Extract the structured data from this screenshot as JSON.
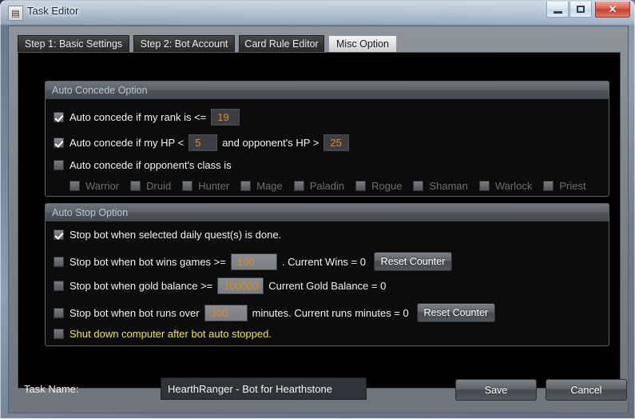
{
  "window": {
    "title": "Task Editor",
    "icon": "app-icon",
    "controls": {
      "minimize": "minimize-icon",
      "maximize": "maximize-icon",
      "close": "✕"
    }
  },
  "tabs": [
    {
      "label": "Step 1: Basic Settings",
      "active": false
    },
    {
      "label": "Step 2: Bot Account",
      "active": false
    },
    {
      "label": "Card Rule Editor",
      "active": false
    },
    {
      "label": "Misc Option",
      "active": true
    }
  ],
  "auto_concede": {
    "header": "Auto Concede Option",
    "rank_rule": {
      "checked": true,
      "label": "Auto concede if my rank is  <=",
      "value": "19"
    },
    "hp_rule": {
      "checked": true,
      "label_before": "Auto concede if my HP <",
      "my_hp": "5",
      "label_middle": "and opponent's HP >",
      "opponent_hp": "25"
    },
    "class_rule": {
      "checked": false,
      "label": "Auto concede if opponent's class is",
      "classes": [
        {
          "label": "Warrior",
          "checked": false
        },
        {
          "label": "Druid",
          "checked": false
        },
        {
          "label": "Hunter",
          "checked": false
        },
        {
          "label": "Mage",
          "checked": false
        },
        {
          "label": "Paladin",
          "checked": false
        },
        {
          "label": "Rogue",
          "checked": false
        },
        {
          "label": "Shaman",
          "checked": false
        },
        {
          "label": "Warlock",
          "checked": false
        },
        {
          "label": "Priest",
          "checked": false
        }
      ]
    }
  },
  "auto_stop": {
    "header": "Auto Stop Option",
    "daily_quest_rule": {
      "checked": true,
      "label": "Stop bot when selected daily quest(s) is done."
    },
    "wins_rule": {
      "checked": false,
      "label_before": "Stop bot when bot wins games >=",
      "value": "100",
      "label_after": ". Current Wins = 0",
      "button": "Reset Counter"
    },
    "gold_rule": {
      "checked": false,
      "label_before": "Stop bot when gold balance >=",
      "value": "100000",
      "label_after": "Current Gold Balance = 0"
    },
    "runtime_rule": {
      "checked": false,
      "label_before": "Stop bot when bot runs over",
      "value": "300",
      "label_after": "minutes. Current runs minutes = 0",
      "button": "Reset Counter"
    },
    "shutdown_rule": {
      "checked": false,
      "label": "Shut down computer after bot auto stopped."
    }
  },
  "footer": {
    "task_name_label": "Task Name:",
    "task_name_value": "HearthRanger - Bot for Hearthstone",
    "save_label": "Save",
    "cancel_label": "Cancel"
  },
  "colors": {
    "accent_value": "#e08a1e",
    "warning": "#e9e93a",
    "group_header_text": "#b6c7d6",
    "panel_bg": "#000000",
    "close_button": "#c5402c"
  }
}
